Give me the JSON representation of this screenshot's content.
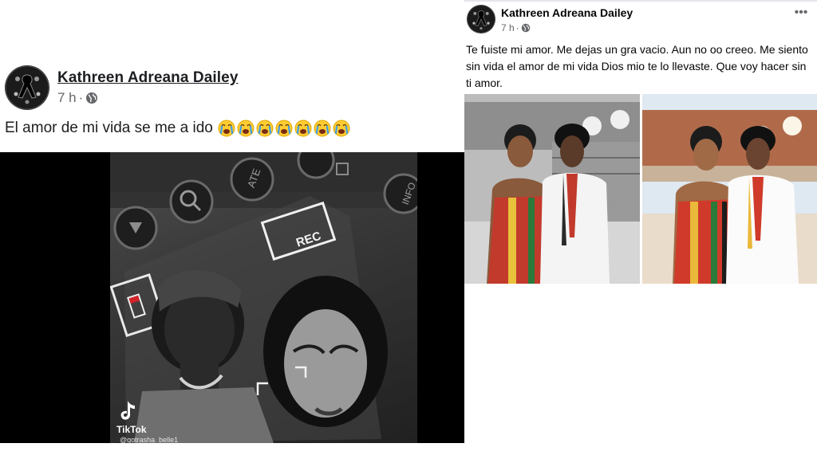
{
  "left_post": {
    "author": "Kathreen Adreana Dailey",
    "time": "7 h",
    "separator": "·",
    "text": "El amor de mi vida se me a ido",
    "emoji": "crying-face",
    "emoji_count": 7,
    "video": {
      "camera_buttons": [
        "ATE",
        "INFO"
      ],
      "rec_label": "REC",
      "watermark": "TikTok",
      "handle": "@gotrasha_belle1"
    }
  },
  "right_post": {
    "author": "Kathreen Adreana Dailey",
    "time": "7 h",
    "separator": "·",
    "more_label": "•••",
    "text": "Te fuiste mi amor. Me dejas un gra vacio. Aun no oo creeo. Me siento sin vida el amor de mi vida Dios mio te lo llevaste. Que voy hacer sin ti amor.",
    "photos": [
      "photo-1",
      "photo-2"
    ]
  },
  "colors": {
    "text_primary": "#1c1e21",
    "text_secondary": "#65676b",
    "divider": "#e4e6eb"
  }
}
